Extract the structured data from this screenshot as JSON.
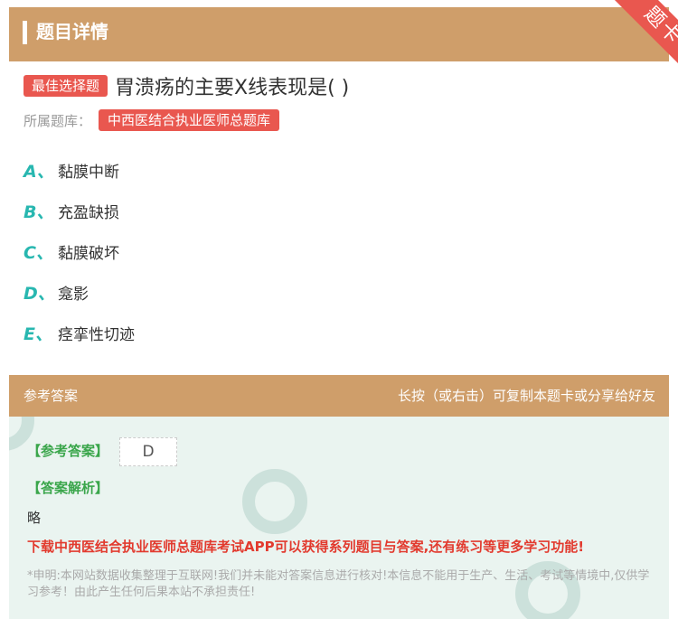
{
  "header": {
    "title": "题目详情",
    "ribbon_label": "题卡"
  },
  "question": {
    "type_badge": "最佳选择题",
    "text": "胃溃疡的主要X线表现是( )",
    "bank_label": "所属题库：",
    "bank_name": "中西医结合执业医师总题库"
  },
  "options": [
    {
      "letter": "A、",
      "text": "黏膜中断"
    },
    {
      "letter": "B、",
      "text": "充盈缺损"
    },
    {
      "letter": "C、",
      "text": "黏膜破坏"
    },
    {
      "letter": "D、",
      "text": "龛影"
    },
    {
      "letter": "E、",
      "text": "痉挛性切迹"
    }
  ],
  "answer_bar": {
    "left": "参考答案",
    "right": "长按（或右击）可复制本题卡或分享给好友"
  },
  "answer": {
    "answer_label": "【参考答案】",
    "answer_value": "D",
    "analysis_label": "【答案解析】",
    "analysis_text": "略",
    "promo": "下载中西医结合执业医师总题库考试APP可以获得系列题目与答案,还有练习等更多学习功能!",
    "disclaimer": "*申明:本网站数据收集整理于互联网!我们并未能对答案信息进行核对!本信息不能用于生产、生活、考试等情境中,仅供学习参考！由此产生任何后果本站不承担责任!"
  },
  "colors": {
    "brand": "#cf9e6a",
    "accent_red": "#e9574f",
    "option_teal": "#28b7b0",
    "answer_green": "#3aa64b"
  }
}
